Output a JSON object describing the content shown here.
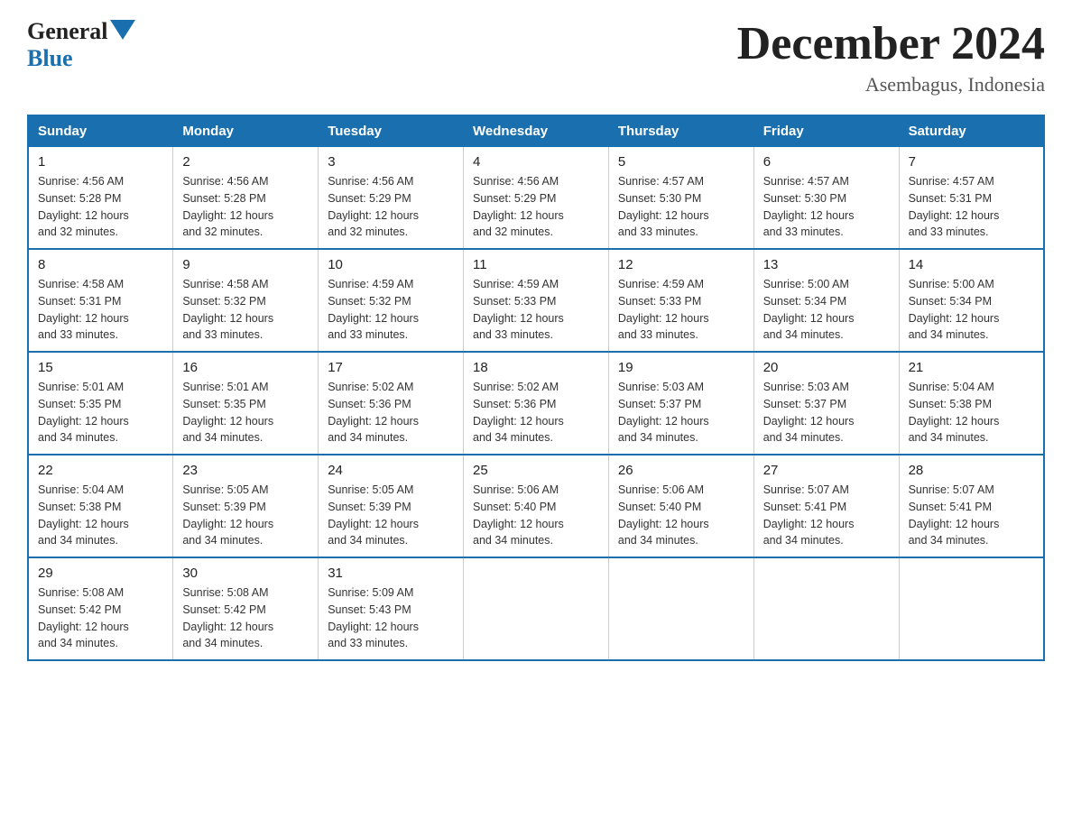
{
  "header": {
    "logo_general": "General",
    "logo_blue": "Blue",
    "month_title": "December 2024",
    "location": "Asembagus, Indonesia"
  },
  "days_of_week": [
    "Sunday",
    "Monday",
    "Tuesday",
    "Wednesday",
    "Thursday",
    "Friday",
    "Saturday"
  ],
  "weeks": [
    [
      {
        "day": "1",
        "sunrise": "4:56 AM",
        "sunset": "5:28 PM",
        "daylight": "12 hours and 32 minutes."
      },
      {
        "day": "2",
        "sunrise": "4:56 AM",
        "sunset": "5:28 PM",
        "daylight": "12 hours and 32 minutes."
      },
      {
        "day": "3",
        "sunrise": "4:56 AM",
        "sunset": "5:29 PM",
        "daylight": "12 hours and 32 minutes."
      },
      {
        "day": "4",
        "sunrise": "4:56 AM",
        "sunset": "5:29 PM",
        "daylight": "12 hours and 32 minutes."
      },
      {
        "day": "5",
        "sunrise": "4:57 AM",
        "sunset": "5:30 PM",
        "daylight": "12 hours and 33 minutes."
      },
      {
        "day": "6",
        "sunrise": "4:57 AM",
        "sunset": "5:30 PM",
        "daylight": "12 hours and 33 minutes."
      },
      {
        "day": "7",
        "sunrise": "4:57 AM",
        "sunset": "5:31 PM",
        "daylight": "12 hours and 33 minutes."
      }
    ],
    [
      {
        "day": "8",
        "sunrise": "4:58 AM",
        "sunset": "5:31 PM",
        "daylight": "12 hours and 33 minutes."
      },
      {
        "day": "9",
        "sunrise": "4:58 AM",
        "sunset": "5:32 PM",
        "daylight": "12 hours and 33 minutes."
      },
      {
        "day": "10",
        "sunrise": "4:59 AM",
        "sunset": "5:32 PM",
        "daylight": "12 hours and 33 minutes."
      },
      {
        "day": "11",
        "sunrise": "4:59 AM",
        "sunset": "5:33 PM",
        "daylight": "12 hours and 33 minutes."
      },
      {
        "day": "12",
        "sunrise": "4:59 AM",
        "sunset": "5:33 PM",
        "daylight": "12 hours and 33 minutes."
      },
      {
        "day": "13",
        "sunrise": "5:00 AM",
        "sunset": "5:34 PM",
        "daylight": "12 hours and 34 minutes."
      },
      {
        "day": "14",
        "sunrise": "5:00 AM",
        "sunset": "5:34 PM",
        "daylight": "12 hours and 34 minutes."
      }
    ],
    [
      {
        "day": "15",
        "sunrise": "5:01 AM",
        "sunset": "5:35 PM",
        "daylight": "12 hours and 34 minutes."
      },
      {
        "day": "16",
        "sunrise": "5:01 AM",
        "sunset": "5:35 PM",
        "daylight": "12 hours and 34 minutes."
      },
      {
        "day": "17",
        "sunrise": "5:02 AM",
        "sunset": "5:36 PM",
        "daylight": "12 hours and 34 minutes."
      },
      {
        "day": "18",
        "sunrise": "5:02 AM",
        "sunset": "5:36 PM",
        "daylight": "12 hours and 34 minutes."
      },
      {
        "day": "19",
        "sunrise": "5:03 AM",
        "sunset": "5:37 PM",
        "daylight": "12 hours and 34 minutes."
      },
      {
        "day": "20",
        "sunrise": "5:03 AM",
        "sunset": "5:37 PM",
        "daylight": "12 hours and 34 minutes."
      },
      {
        "day": "21",
        "sunrise": "5:04 AM",
        "sunset": "5:38 PM",
        "daylight": "12 hours and 34 minutes."
      }
    ],
    [
      {
        "day": "22",
        "sunrise": "5:04 AM",
        "sunset": "5:38 PM",
        "daylight": "12 hours and 34 minutes."
      },
      {
        "day": "23",
        "sunrise": "5:05 AM",
        "sunset": "5:39 PM",
        "daylight": "12 hours and 34 minutes."
      },
      {
        "day": "24",
        "sunrise": "5:05 AM",
        "sunset": "5:39 PM",
        "daylight": "12 hours and 34 minutes."
      },
      {
        "day": "25",
        "sunrise": "5:06 AM",
        "sunset": "5:40 PM",
        "daylight": "12 hours and 34 minutes."
      },
      {
        "day": "26",
        "sunrise": "5:06 AM",
        "sunset": "5:40 PM",
        "daylight": "12 hours and 34 minutes."
      },
      {
        "day": "27",
        "sunrise": "5:07 AM",
        "sunset": "5:41 PM",
        "daylight": "12 hours and 34 minutes."
      },
      {
        "day": "28",
        "sunrise": "5:07 AM",
        "sunset": "5:41 PM",
        "daylight": "12 hours and 34 minutes."
      }
    ],
    [
      {
        "day": "29",
        "sunrise": "5:08 AM",
        "sunset": "5:42 PM",
        "daylight": "12 hours and 34 minutes."
      },
      {
        "day": "30",
        "sunrise": "5:08 AM",
        "sunset": "5:42 PM",
        "daylight": "12 hours and 34 minutes."
      },
      {
        "day": "31",
        "sunrise": "5:09 AM",
        "sunset": "5:43 PM",
        "daylight": "12 hours and 33 minutes."
      },
      null,
      null,
      null,
      null
    ]
  ],
  "labels": {
    "sunrise": "Sunrise:",
    "sunset": "Sunset:",
    "daylight": "Daylight:"
  }
}
